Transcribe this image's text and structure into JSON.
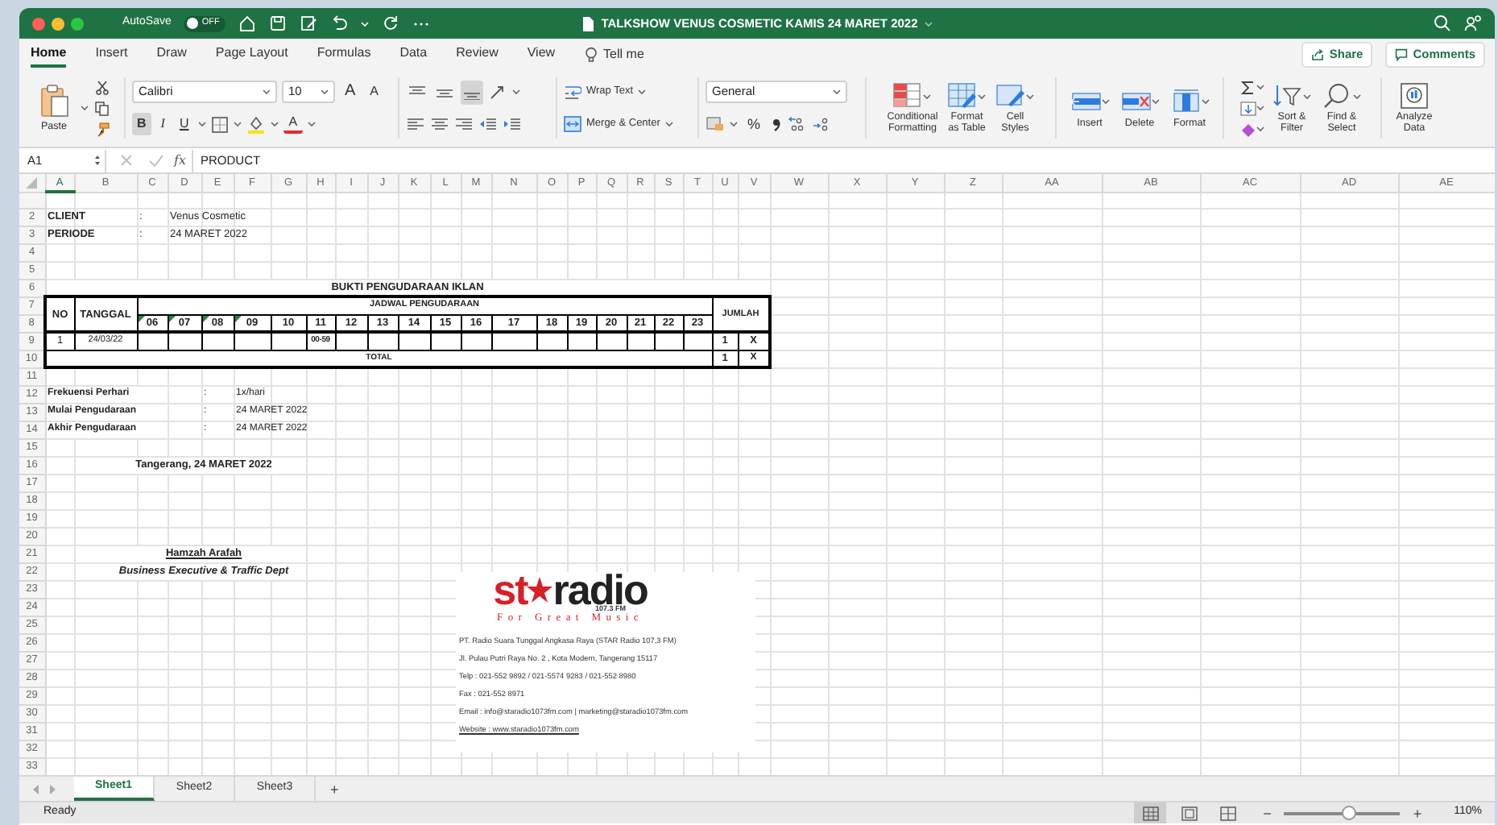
{
  "window": {
    "title": "TALKSHOW VENUS COSMETIC KAMIS 24 MARET 2022"
  },
  "autosave": {
    "label": "AutoSave",
    "state": "OFF",
    "on": false
  },
  "ribbon_tabs": [
    {
      "label": "Home",
      "selected": true
    },
    {
      "label": "Insert",
      "selected": false
    },
    {
      "label": "Draw",
      "selected": false
    },
    {
      "label": "Page Layout",
      "selected": false
    },
    {
      "label": "Formulas",
      "selected": false
    },
    {
      "label": "Data",
      "selected": false
    },
    {
      "label": "Review",
      "selected": false
    },
    {
      "label": "View",
      "selected": false
    }
  ],
  "tell_me": "Tell me",
  "share": "Share",
  "comments": "Comments",
  "paste": "Paste",
  "font": {
    "name": "Calibri",
    "size": "10",
    "grow": "A",
    "shrink": "A",
    "color_letter": "A"
  },
  "format_toggles": [
    {
      "kind": "bold",
      "label": "B",
      "on": true
    },
    {
      "kind": "italic",
      "label": "I",
      "on": false
    },
    {
      "kind": "underline",
      "label": "U",
      "on": false
    }
  ],
  "vertical_align": [
    {
      "kind": "top",
      "selected": false
    },
    {
      "kind": "middle",
      "selected": false
    },
    {
      "kind": "bottom",
      "selected": true
    }
  ],
  "wrap_text": "Wrap Text",
  "merge": "Merge & Center",
  "number_format": "General",
  "percent": "%",
  "large_buttons": [
    {
      "kind": "conditional",
      "lines": [
        "Conditional",
        "Formatting"
      ]
    },
    {
      "kind": "table",
      "lines": [
        "Format",
        "as Table"
      ]
    },
    {
      "kind": "styles",
      "lines": [
        "Cell",
        "Styles"
      ]
    },
    {
      "kind": "insert",
      "lines": [
        "Insert"
      ]
    },
    {
      "kind": "delete",
      "lines": [
        "Delete"
      ]
    },
    {
      "kind": "format",
      "lines": [
        "Format"
      ]
    },
    {
      "kind": "sort",
      "lines": [
        "Sort &",
        "Filter"
      ]
    },
    {
      "kind": "find",
      "lines": [
        "Find &",
        "Select"
      ]
    },
    {
      "kind": "analyze",
      "lines": [
        "Analyze",
        "Data"
      ]
    }
  ],
  "name_box": "A1",
  "fx": "fx",
  "formula": "PRODUCT",
  "columns": [
    "A",
    "B",
    "C",
    "D",
    "E",
    "F",
    "G",
    "H",
    "I",
    "J",
    "K",
    "L",
    "M",
    "N",
    "O",
    "P",
    "Q",
    "R",
    "S",
    "T",
    "U",
    "V",
    "W",
    "X",
    "Y",
    "Z",
    "AA",
    "AB",
    "AC",
    "AD",
    "AE"
  ],
  "row_numbers": [
    "2",
    "3",
    "4",
    "5",
    "6",
    "7",
    "8",
    "9",
    "10",
    "11",
    "12",
    "13",
    "14",
    "15",
    "16",
    "17",
    "18",
    "19",
    "20",
    "21",
    "22",
    "23",
    "24",
    "25",
    "26",
    "27",
    "28",
    "29",
    "30",
    "31",
    "32",
    "33"
  ],
  "info": [
    {
      "label": "CLIENT",
      "separator": ":",
      "value": "Venus Cosmetic"
    },
    {
      "label": "PERIODE",
      "separator": ":",
      "value": "24 MARET 2022"
    }
  ],
  "schedule": {
    "title": "BUKTI PENGUDARAAN IKLAN",
    "no": "NO",
    "date": "TANGGAL",
    "schedule": "JADWAL PENGUDARAAN",
    "total_header": "JUMLAH",
    "hours": [
      {
        "label": "06",
        "flag": true
      },
      {
        "label": "07",
        "flag": true
      },
      {
        "label": "08",
        "flag": true
      },
      {
        "label": "09",
        "flag": true
      },
      {
        "label": "10",
        "flag": false
      },
      {
        "label": "11",
        "flag": false,
        "row_time": "00-59"
      },
      {
        "label": "12",
        "flag": false
      },
      {
        "label": "13",
        "flag": false
      },
      {
        "label": "14",
        "flag": false
      },
      {
        "label": "15",
        "flag": false
      },
      {
        "label": "16",
        "flag": false
      },
      {
        "label": "17",
        "flag": false
      },
      {
        "label": "18",
        "flag": false
      },
      {
        "label": "19",
        "flag": false
      },
      {
        "label": "20",
        "flag": false
      },
      {
        "label": "21",
        "flag": false
      },
      {
        "label": "22",
        "flag": false
      },
      {
        "label": "23",
        "flag": false
      }
    ],
    "row": {
      "no": "1",
      "date": "24/03/22",
      "count": "1",
      "mark": "X"
    },
    "total": {
      "label": "TOTAL",
      "count": "1",
      "mark": "X"
    }
  },
  "airing": [
    {
      "label": "Frekuensi Perhari",
      "separator": ":",
      "value": "1x/hari"
    },
    {
      "label": "Mulai Pengudaraan",
      "separator": ":",
      "value": "24 MARET 2022"
    },
    {
      "label": "Akhir Pengudaraan",
      "separator": ":",
      "value": "24 MARET 2022"
    }
  ],
  "signature": {
    "place_date": "Tangerang, 24 MARET 2022",
    "name": "Hamzah Arafah",
    "position": "Business Executive & Traffic Dept"
  },
  "letterhead": {
    "brand_left": "st",
    "brand_right": "radio",
    "frequency": "107.3 FM",
    "tagline": "For Great Music",
    "lines": [
      {
        "text": "PT. Radio Suara Tunggal Angkasa Raya (STAR Radio 107,3 FM)",
        "link": false
      },
      {
        "text": "Jl. Pulau Putri Raya No. 2 , Kota Modern, Tangerang 15117",
        "link": false
      },
      {
        "text": "Telp : 021-552 9892 / 021-5574 9283 / 021-552 8980",
        "link": false
      },
      {
        "text": "Fax : 021-552 8971",
        "link": false
      },
      {
        "text": "Email : info@staradio1073fm.com | marketing@staradio1073fm.com",
        "link": false
      },
      {
        "text": "Website : www.staradio1073fm.com",
        "link": true
      }
    ]
  },
  "sheets": [
    {
      "label": "Sheet1",
      "selected": true
    },
    {
      "label": "Sheet2",
      "selected": false
    },
    {
      "label": "Sheet3",
      "selected": false
    }
  ],
  "add_sheet": "+",
  "status": "Ready",
  "views": [
    {
      "kind": "normal",
      "selected": true
    },
    {
      "kind": "page_layout",
      "selected": false
    },
    {
      "kind": "page_break",
      "selected": false
    }
  ],
  "zoom": {
    "minus": "−",
    "plus": "+",
    "level": 0.55,
    "label": "110%"
  }
}
